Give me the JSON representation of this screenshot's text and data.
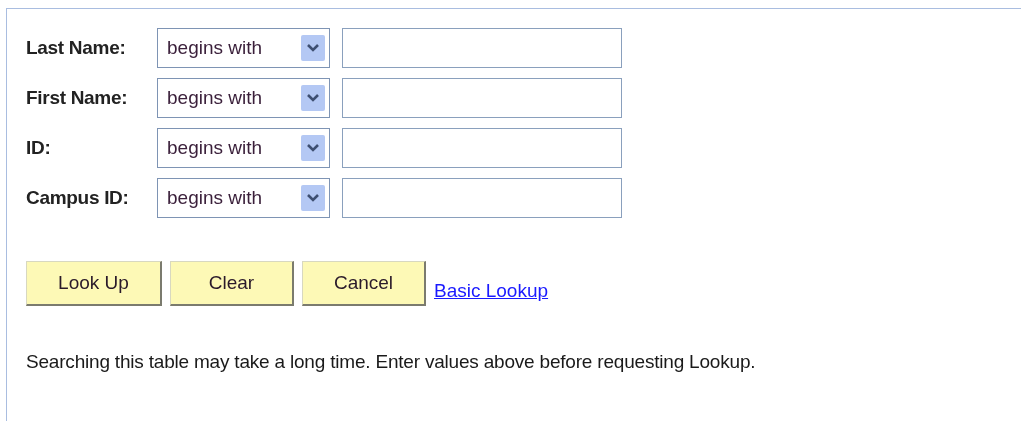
{
  "criteria": [
    {
      "label": "Last Name:",
      "operator": "begins with"
    },
    {
      "label": "First Name:",
      "operator": "begins with"
    },
    {
      "label": "ID:",
      "operator": "begins with"
    },
    {
      "label": "Campus ID:",
      "operator": "begins with"
    }
  ],
  "buttons": [
    "Look Up",
    "Clear",
    "Cancel"
  ],
  "link": "Basic Lookup",
  "note": "Searching this table may take a long time. Enter values above before requesting Lookup."
}
